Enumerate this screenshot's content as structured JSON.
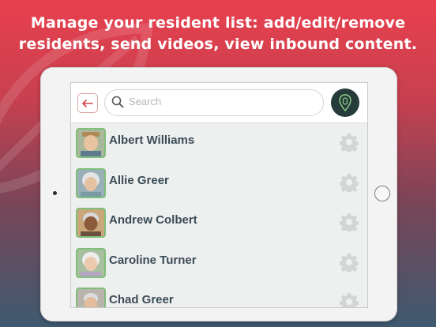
{
  "headline": {
    "line1": "Manage your resident list: add/edit/remove",
    "line2": "residents, send videos, view inbound content."
  },
  "colors": {
    "accent_red": "#e8404e",
    "header_dark": "#263c3a",
    "name_text": "#3a4b55",
    "avatar_border": "#7fbf7b"
  },
  "toolbar": {
    "back_icon": "back-arrow-icon",
    "search_placeholder": "Search",
    "action_icon": "pin-icon"
  },
  "residents": [
    {
      "name": "Albert Williams",
      "avatar": "avatar-1"
    },
    {
      "name": "Allie Greer",
      "avatar": "avatar-2"
    },
    {
      "name": "Andrew Colbert",
      "avatar": "avatar-3"
    },
    {
      "name": "Caroline Turner",
      "avatar": "avatar-4"
    },
    {
      "name": "Chad Greer",
      "avatar": "avatar-5"
    }
  ]
}
